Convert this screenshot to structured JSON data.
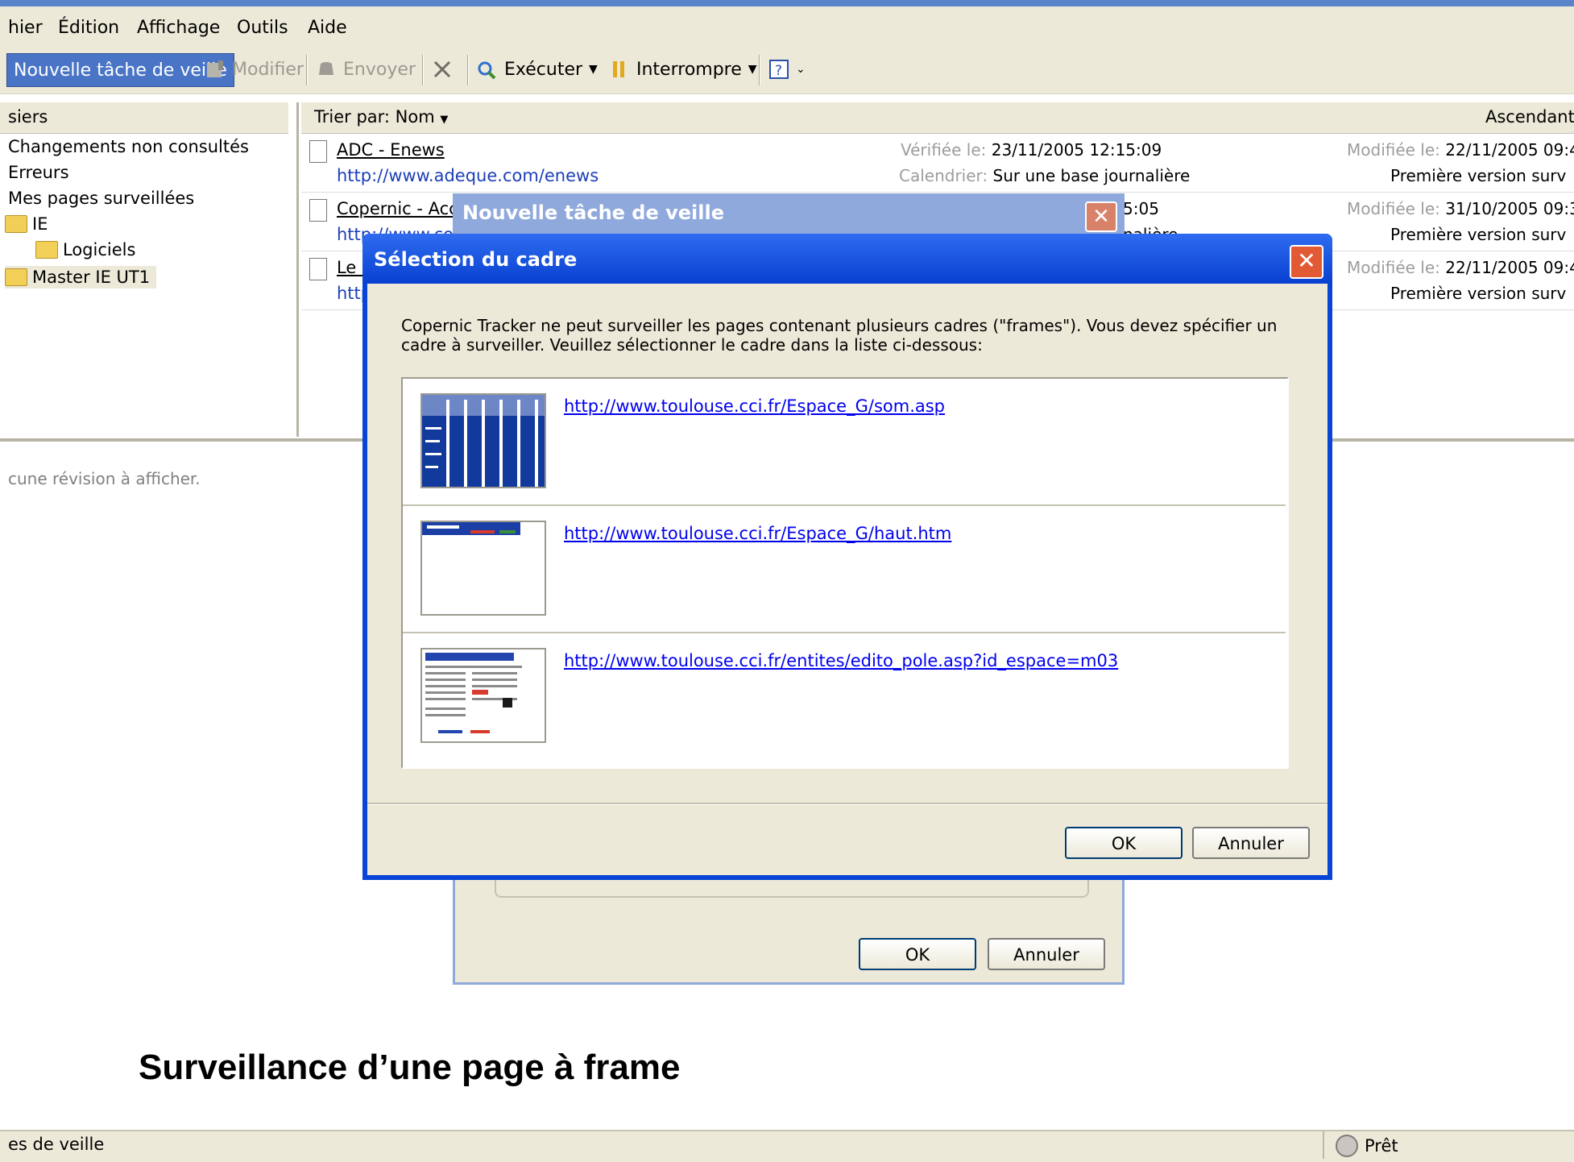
{
  "menu": [
    "hier",
    "Édition",
    "Affichage",
    "Outils",
    "Aide"
  ],
  "toolbar": {
    "new_task": "Nouvelle tâche de veille",
    "modify": "Modifier",
    "send": "Envoyer",
    "run": "Exécuter",
    "pause": "Interrompre"
  },
  "left": {
    "header": "siers",
    "items": [
      "Changements non consultés",
      "Erreurs",
      "Mes pages surveillées",
      "IE",
      "Logiciels",
      "Master IE UT1"
    ]
  },
  "list": {
    "sort_label": "Trier par: Nom",
    "order_label": "Ascendant",
    "rows": [
      {
        "title": "ADC - Enews",
        "url": "http://www.adeque.com/enews",
        "checked_label": "Vérifiée le:",
        "checked_value": "23/11/2005 12:15:09",
        "calendar_label": "Calendrier:",
        "calendar_value": "Sur une base journalière",
        "modified_label": "Modifiée le:",
        "modified_value": "22/11/2005 09:4",
        "first_version": "Première version surv"
      },
      {
        "title": "Copernic - Accu",
        "url": "http://www.co",
        "checked_value": "5:05",
        "calendar_value": "nalière",
        "modified_label": "Modifiée le:",
        "modified_value": "31/10/2005 09:3",
        "first_version": "Première version surv"
      },
      {
        "title": "Le M",
        "url": "http",
        "modified_label": "Modifiée le:",
        "modified_value": "22/11/2005 09:4",
        "first_version": "Première version surv"
      }
    ]
  },
  "bottom": {
    "no_revision": "cune révision à afficher."
  },
  "dialog_back": {
    "title": "Nouvelle tâche de veille",
    "ok": "OK",
    "cancel": "Annuler"
  },
  "dialog": {
    "title": "Sélection du cadre",
    "message": "Copernic Tracker ne peut surveiller les pages contenant plusieurs cadres (\"frames\"). Vous devez spécifier un cadre à surveiller. Veuillez sélectionner le cadre dans la liste ci-dessous:",
    "frames": [
      "http://www.toulouse.cci.fr/Espace_G/som.asp",
      "http://www.toulouse.cci.fr/Espace_G/haut.htm",
      "http://www.toulouse.cci.fr/entites/edito_pole.asp?id_espace=m03"
    ],
    "ok": "OK",
    "cancel": "Annuler"
  },
  "caption": "Surveillance d’une page à frame",
  "status": {
    "left": "es de veille",
    "right": "Prêt"
  }
}
